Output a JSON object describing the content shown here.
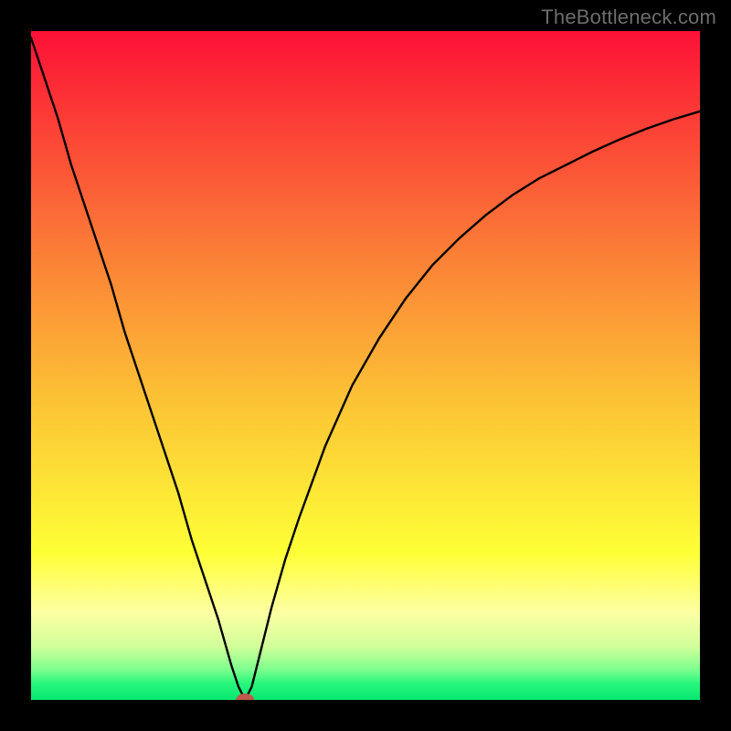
{
  "watermark": "TheBottleneck.com",
  "chart_data": {
    "type": "line",
    "title": "",
    "xlabel": "",
    "ylabel": "",
    "xlim": [
      0,
      100
    ],
    "ylim": [
      0,
      100
    ],
    "grid": false,
    "series": [
      {
        "name": "left-branch",
        "x": [
          0,
          2,
          4,
          6,
          8,
          10,
          12,
          14,
          16,
          18,
          20,
          22,
          24,
          26,
          28,
          30,
          31,
          32
        ],
        "y": [
          99,
          93,
          87,
          80,
          74,
          68,
          62,
          55,
          49,
          43,
          37,
          31,
          24,
          18,
          12,
          5,
          2,
          0
        ]
      },
      {
        "name": "right-branch",
        "x": [
          32,
          33,
          34,
          36,
          38,
          40,
          44,
          48,
          52,
          56,
          60,
          64,
          68,
          72,
          76,
          80,
          84,
          88,
          92,
          96,
          100
        ],
        "y": [
          0,
          2,
          6,
          14,
          21,
          27,
          38,
          47,
          54,
          60,
          65,
          69,
          72.5,
          75.5,
          78,
          80,
          82,
          83.8,
          85.4,
          86.8,
          88
        ]
      }
    ],
    "marker": {
      "x": 32,
      "y": 0,
      "color": "#bf5a4c"
    },
    "background": {
      "type": "vertical-gradient",
      "stops": [
        {
          "offset": 0.0,
          "color": "#fc1136"
        },
        {
          "offset": 0.3,
          "color": "#fb7437"
        },
        {
          "offset": 0.55,
          "color": "#fcc235"
        },
        {
          "offset": 0.78,
          "color": "#feff36"
        },
        {
          "offset": 0.87,
          "color": "#fdffa3"
        },
        {
          "offset": 0.92,
          "color": "#d1ff9a"
        },
        {
          "offset": 0.955,
          "color": "#7cff8e"
        },
        {
          "offset": 0.975,
          "color": "#29f67c"
        },
        {
          "offset": 1.0,
          "color": "#05e870"
        }
      ]
    }
  }
}
